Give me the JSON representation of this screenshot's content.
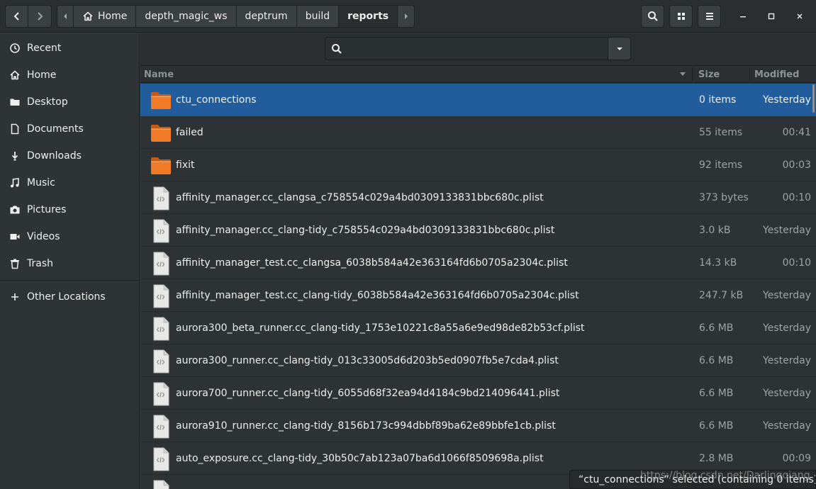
{
  "header": {
    "breadcrumbs": [
      {
        "label": "Home",
        "icon": "home-icon"
      },
      {
        "label": "depth_magic_ws"
      },
      {
        "label": "deptrum"
      },
      {
        "label": "build"
      },
      {
        "label": "reports",
        "active": true
      }
    ]
  },
  "sidebar": {
    "items": [
      {
        "label": "Recent",
        "icon": "clock-icon"
      },
      {
        "label": "Home",
        "icon": "home-icon"
      },
      {
        "label": "Desktop",
        "icon": "folder-icon"
      },
      {
        "label": "Documents",
        "icon": "document-icon"
      },
      {
        "label": "Downloads",
        "icon": "download-icon"
      },
      {
        "label": "Music",
        "icon": "music-icon"
      },
      {
        "label": "Pictures",
        "icon": "camera-icon"
      },
      {
        "label": "Videos",
        "icon": "video-icon"
      },
      {
        "label": "Trash",
        "icon": "trash-icon"
      },
      {
        "label": "Other Locations",
        "icon": "plus-icon"
      }
    ]
  },
  "search": {
    "placeholder": ""
  },
  "columns": {
    "name": "Name",
    "size": "Size",
    "modified": "Modified"
  },
  "files": [
    {
      "name": "ctu_connections",
      "size": "0 items",
      "modified": "Yesterday",
      "type": "folder",
      "selected": true
    },
    {
      "name": "failed",
      "size": "55 items",
      "modified": "00:41",
      "type": "folder"
    },
    {
      "name": "fixit",
      "size": "92 items",
      "modified": "00:03",
      "type": "folder"
    },
    {
      "name": "affinity_manager.cc_clangsa_c758554c029a4bd0309133831bbc680c.plist",
      "size": "373 bytes",
      "modified": "00:10",
      "type": "file"
    },
    {
      "name": "affinity_manager.cc_clang-tidy_c758554c029a4bd0309133831bbc680c.plist",
      "size": "3.0 kB",
      "modified": "Yesterday",
      "type": "file"
    },
    {
      "name": "affinity_manager_test.cc_clangsa_6038b584a42e363164fd6b0705a2304c.plist",
      "size": "14.3 kB",
      "modified": "00:10",
      "type": "file"
    },
    {
      "name": "affinity_manager_test.cc_clang-tidy_6038b584a42e363164fd6b0705a2304c.plist",
      "size": "247.7 kB",
      "modified": "Yesterday",
      "type": "file"
    },
    {
      "name": "aurora300_beta_runner.cc_clang-tidy_1753e10221c8a55a6e9ed98de82b53cf.plist",
      "size": "6.6 MB",
      "modified": "Yesterday",
      "type": "file"
    },
    {
      "name": "aurora300_runner.cc_clang-tidy_013c33005d6d203b5ed0907fb5e7cda4.plist",
      "size": "6.6 MB",
      "modified": "Yesterday",
      "type": "file"
    },
    {
      "name": "aurora700_runner.cc_clang-tidy_6055d68f32ea94d4184c9bd214096441.plist",
      "size": "6.6 MB",
      "modified": "Yesterday",
      "type": "file"
    },
    {
      "name": "aurora910_runner.cc_clang-tidy_8156b173c994dbbf89ba62e89bbfe1cb.plist",
      "size": "6.6 MB",
      "modified": "Yesterday",
      "type": "file"
    },
    {
      "name": "auto_exposure.cc_clang-tidy_30b50c7ab123a07ba6d1066f8509698a.plist",
      "size": "2.8 MB",
      "modified": "00:09",
      "type": "file"
    },
    {
      "name": "",
      "size": "",
      "modified": "",
      "type": "file"
    }
  ],
  "status": {
    "text": "“ctu_connections” selected  (containing 0 items)"
  },
  "watermark": {
    "text": "https://blog.csdn.net/Darlingqiang"
  },
  "colors": {
    "selection": "#215d9c",
    "folder": "#f07a26",
    "background": "#2d3234"
  }
}
